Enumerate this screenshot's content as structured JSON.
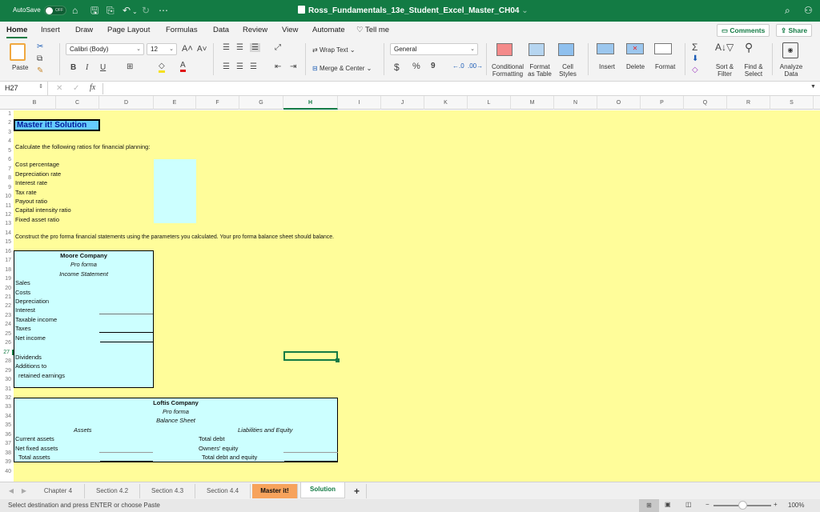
{
  "titlebar": {
    "autosave_label": "AutoSave",
    "autosave_state": "OFF",
    "doc_title": "Ross_Fundamentals_13e_Student_Excel_Master_CH04",
    "icons": [
      "home-icon",
      "save-icon",
      "save-as-icon",
      "undo-icon",
      "redo-icon",
      "more-icon",
      "search-icon",
      "share-people-icon"
    ]
  },
  "menu": {
    "tabs": [
      "Home",
      "Insert",
      "Draw",
      "Page Layout",
      "Formulas",
      "Data",
      "Review",
      "View",
      "Automate"
    ],
    "tell_me": "Tell me",
    "comments": "Comments",
    "share": "Share"
  },
  "ribbon": {
    "paste": "Paste",
    "font_name": "Calibri (Body)",
    "font_size": "12",
    "bold": "B",
    "italic": "I",
    "underline": "U",
    "wrap_text": "Wrap Text",
    "merge_center": "Merge & Center",
    "number_format": "General",
    "currency": "$",
    "percent": "%",
    "comma": "9",
    "conditional_formatting": [
      "Conditional",
      "Formatting"
    ],
    "format_as_table": [
      "Format",
      "as Table"
    ],
    "cell_styles": [
      "Cell",
      "Styles"
    ],
    "insert": "Insert",
    "delete": "Delete",
    "format": "Format",
    "sort_filter": [
      "Sort &",
      "Filter"
    ],
    "find_select": [
      "Find &",
      "Select"
    ],
    "analyze_data": [
      "Analyze",
      "Data"
    ]
  },
  "formula_bar": {
    "name_box": "H27",
    "fx": "fx",
    "value": ""
  },
  "columns": [
    "B",
    "C",
    "D",
    "E",
    "F",
    "G",
    "H",
    "I",
    "J",
    "K",
    "L",
    "M",
    "N",
    "O",
    "P",
    "Q",
    "R",
    "S"
  ],
  "selected_column": "H",
  "rows": [
    "1",
    "2",
    "3",
    "4",
    "5",
    "6",
    "7",
    "8",
    "9",
    "10",
    "11",
    "12",
    "13",
    "14",
    "15",
    "16",
    "17",
    "18",
    "19",
    "20",
    "21",
    "22",
    "23",
    "24",
    "25",
    "26",
    "27",
    "28",
    "29",
    "30",
    "31",
    "32",
    "33",
    "34",
    "35",
    "36",
    "37",
    "38",
    "39",
    "40"
  ],
  "selected_row": "27",
  "sheet": {
    "title": "Master it! Solution",
    "instruction1": "Calculate the following ratios for financial planning:",
    "ratios": [
      "Cost percentage",
      "Depreciation rate",
      "Interest rate",
      "Tax rate",
      "Payout ratio",
      "Capital intensity ratio",
      "Fixed asset ratio"
    ],
    "instruction2": "Construct the pro forma financial statements using the parameters you calculated. Your pro forma balance sheet should balance.",
    "income_statement": {
      "company": "Moore Company",
      "subtitle1": "Pro forma",
      "subtitle2": "Income Statement",
      "lines": [
        "Sales",
        "Costs",
        "Depreciation",
        "Interest",
        "Taxable income",
        "Taxes",
        "Net income"
      ],
      "dividends": "Dividends",
      "additions1": "Additions to",
      "additions2": "retained earnings"
    },
    "balance_sheet": {
      "company": "Loftis Company",
      "subtitle1": "Pro forma",
      "subtitle2": "Balance Sheet",
      "assets_header": "Assets",
      "liab_header": "Liabilities and Equity",
      "current_assets": "Current assets",
      "net_fixed_assets": "Net fixed assets",
      "total_assets": "Total assets",
      "total_debt": "Total debt",
      "owners_equity": "Owners' equity",
      "total_debt_equity": "Total debt and equity"
    }
  },
  "sheet_tabs": [
    "Chapter 4",
    "Section 4.2",
    "Section 4.3",
    "Section 4.4",
    "Master it!",
    "Solution"
  ],
  "active_tab": "Solution",
  "status": {
    "message": "Select destination and press ENTER or choose Paste",
    "zoom": "100%",
    "zoom_fraction": 0.5
  }
}
